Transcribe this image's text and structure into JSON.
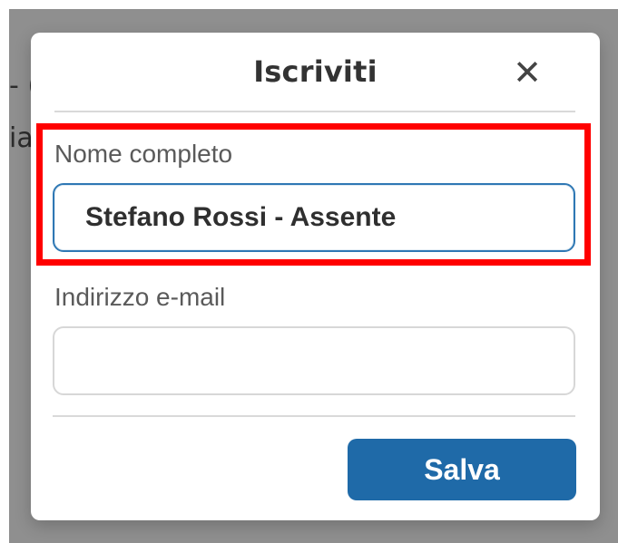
{
  "background": {
    "peek_text_1": "- (",
    "peek_text_2": "ia"
  },
  "dialog": {
    "title": "Iscriviti",
    "close_icon": "close-icon",
    "fields": {
      "name_label": "Nome completo",
      "name_value": "Stefano Rossi - Assente",
      "email_label": "Indirizzo e-mail",
      "email_value": ""
    },
    "actions": {
      "save_label": "Salva"
    }
  },
  "colors": {
    "accent": "#1f6aa8",
    "highlight": "#ff0000",
    "backdrop": "#8f8f8f"
  }
}
